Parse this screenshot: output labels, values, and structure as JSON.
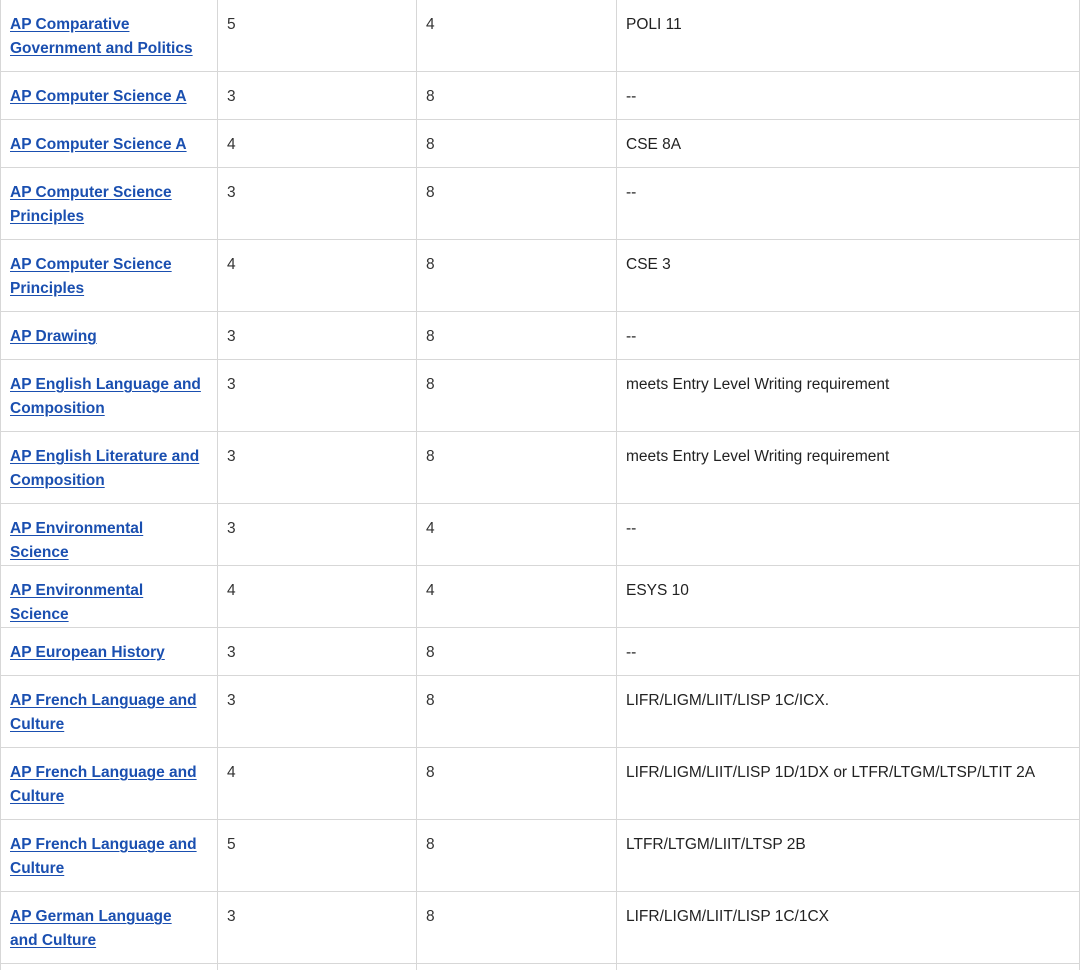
{
  "table": {
    "rows": [
      {
        "course": "AP Comparative Government and Politics",
        "score": "5",
        "units": "4",
        "credit": "POLI 11"
      },
      {
        "course": "AP Computer Science A",
        "score": "3",
        "units": "8",
        "credit": "--"
      },
      {
        "course": "AP Computer Science A",
        "score": "4",
        "units": "8",
        "credit": "CSE 8A"
      },
      {
        "course": "AP Computer Science Principles",
        "score": "3",
        "units": "8",
        "credit": "--"
      },
      {
        "course": "AP Computer Science Principles",
        "score": "4",
        "units": "8",
        "credit": "CSE 3"
      },
      {
        "course": "AP Drawing",
        "score": "3",
        "units": "8",
        "credit": "--"
      },
      {
        "course": "AP English Language and Composition",
        "score": "3",
        "units": "8",
        "credit": "meets Entry Level Writing requirement"
      },
      {
        "course": "AP English Literature and Composition",
        "score": "3",
        "units": "8",
        "credit": "meets Entry Level Writing requirement"
      },
      {
        "course": "AP Environmental Science",
        "score": "3",
        "units": "4",
        "credit": "--"
      },
      {
        "course": "AP Environmental Science",
        "score": "4",
        "units": "4",
        "credit": "ESYS 10"
      },
      {
        "course": "AP European History",
        "score": "3",
        "units": "8",
        "credit": "--"
      },
      {
        "course": "AP French Language and Culture",
        "score": "3",
        "units": "8",
        "credit": "LIFR/LIGM/LIIT/LISP 1C/ICX."
      },
      {
        "course": "AP French Language and Culture",
        "score": "4",
        "units": "8",
        "credit": "LIFR/LIGM/LIIT/LISP 1D/1DX or LTFR/LTGM/LTSP/LTIT 2A"
      },
      {
        "course": "AP French Language and Culture",
        "score": "5",
        "units": "8",
        "credit": "LTFR/LTGM/LIIT/LTSP 2B"
      },
      {
        "course": "AP German Language and Culture",
        "score": "3",
        "units": "8",
        "credit": "LIFR/LIGM/LIIT/LISP 1C/1CX"
      }
    ]
  }
}
